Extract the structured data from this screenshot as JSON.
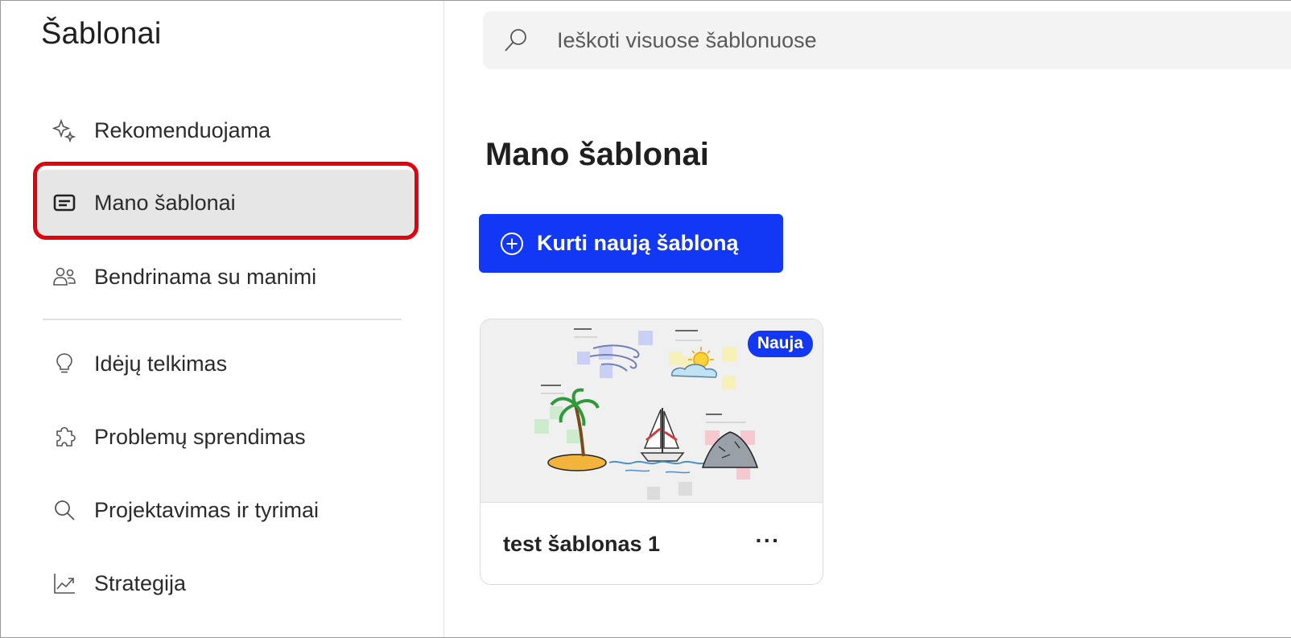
{
  "sidebar": {
    "title": "Šablonai",
    "items": [
      {
        "label": "Rekomenduojama",
        "icon": "sparkle-icon"
      },
      {
        "label": "Mano šablonai",
        "icon": "template-icon",
        "selected": true
      },
      {
        "label": "Bendrinama su manimi",
        "icon": "people-icon"
      },
      {
        "label": "Idėjų telkimas",
        "icon": "lightbulb-icon"
      },
      {
        "label": "Problemų sprendimas",
        "icon": "puzzle-icon"
      },
      {
        "label": "Projektavimas ir tyrimai",
        "icon": "search-icon"
      },
      {
        "label": "Strategija",
        "icon": "trend-chart-icon"
      }
    ]
  },
  "search": {
    "placeholder": "Ieškoti visuose šablonuose",
    "icon": "search-icon"
  },
  "main": {
    "title": "Mano šablonai",
    "create_button": {
      "label": "Kurti naują šabloną",
      "icon": "plus-circle-icon"
    },
    "cards": [
      {
        "name": "test šablonas 1",
        "badge": "Nauja",
        "more_label": "···",
        "thumbnail": "whiteboard-beach-illustration"
      }
    ]
  },
  "colors": {
    "accent": "#1238f5",
    "highlight_box": "#e3000b",
    "selected_bg": "#e6e6e6"
  }
}
